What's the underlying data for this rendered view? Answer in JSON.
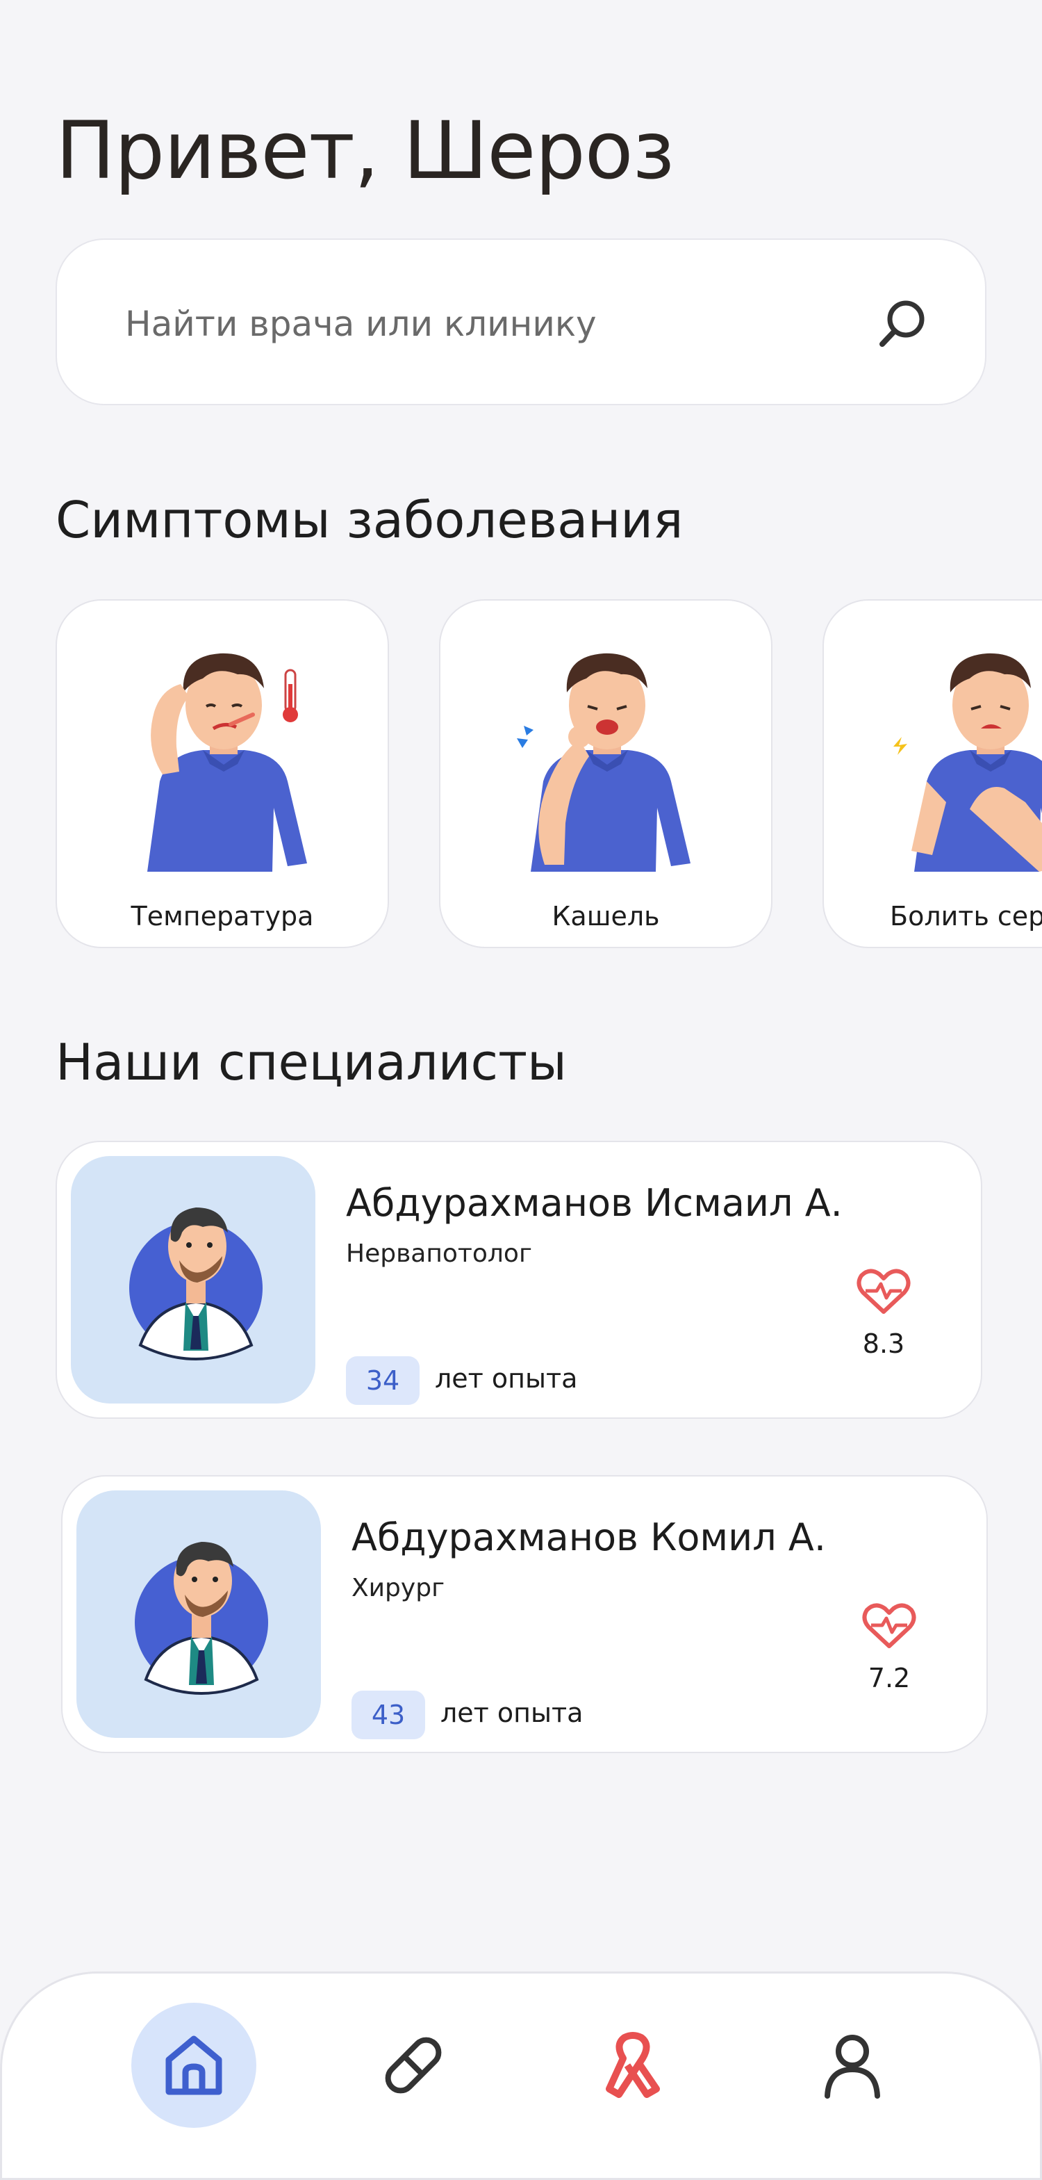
{
  "header": {
    "greeting": "Привет, Шероз"
  },
  "search": {
    "placeholder": "Найти врача или клинику",
    "icon": "search-icon"
  },
  "symptoms": {
    "title": "Симптомы заболевания",
    "items": [
      {
        "label": "Температура",
        "icon": "fever-illustration"
      },
      {
        "label": "Кашель",
        "icon": "cough-illustration"
      },
      {
        "label": "Болить серд",
        "icon": "heartache-illustration"
      }
    ]
  },
  "specialists": {
    "title": "Наши специалисты",
    "items": [
      {
        "name": "Абдурахманов Исмаил А.",
        "specialty": "Нервапотолог",
        "experience": "34",
        "experience_label": "лет опыта",
        "rating": "8.3"
      },
      {
        "name": "Абдурахманов Комил А.",
        "specialty": "Хирург",
        "experience": "43",
        "experience_label": "лет опыта",
        "rating": "7.2"
      }
    ]
  },
  "bottom_nav": {
    "items": [
      {
        "icon": "home-icon",
        "active": true
      },
      {
        "icon": "pill-icon",
        "active": false
      },
      {
        "icon": "ribbon-icon",
        "active": false
      },
      {
        "icon": "profile-icon",
        "active": false
      }
    ]
  },
  "colors": {
    "accent": "#3e5fce",
    "accent_light": "#d7e4fb",
    "heart": "#e85a5a",
    "avatar_bg": "#d4e4f7"
  }
}
